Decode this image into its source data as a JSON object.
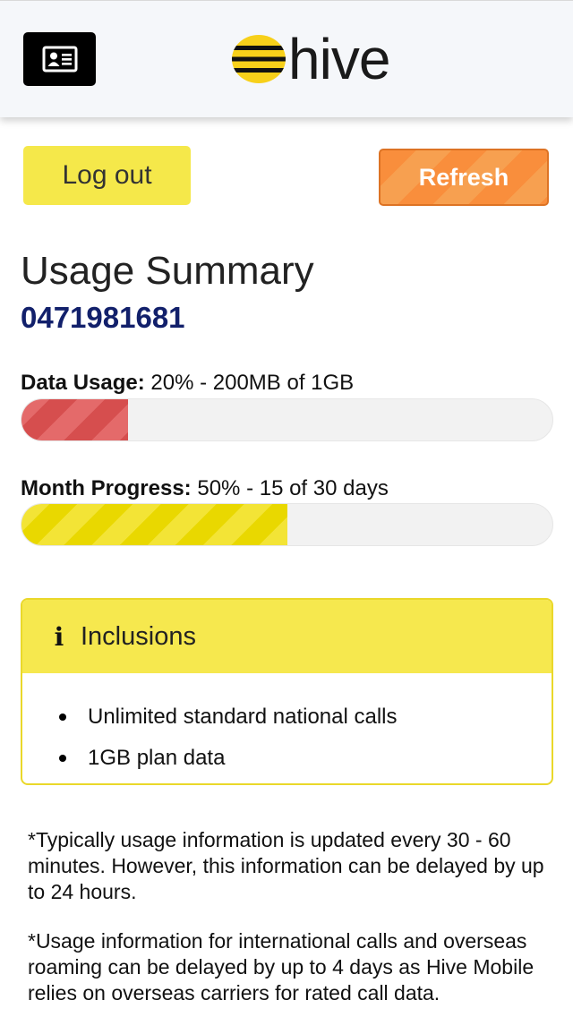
{
  "header": {
    "brand": "hive",
    "brand_color": "#f7d01a",
    "card_icon": "id-card-icon"
  },
  "actions": {
    "logout_label": "Log out",
    "refresh_label": "Refresh"
  },
  "summary": {
    "title": "Usage Summary",
    "phone": "0471981681"
  },
  "data_usage": {
    "label": "Data Usage:",
    "value_text": "20% - 200MB of 1GB",
    "percent": 20,
    "color": "#d64e4e"
  },
  "month_progress": {
    "label": "Month Progress:",
    "value_text": "50% - 15 of 30 days",
    "percent": 50,
    "color": "#e9d800"
  },
  "inclusions": {
    "icon": "info-icon",
    "title": "Inclusions",
    "items": [
      "Unlimited standard national calls",
      "1GB plan data"
    ]
  },
  "notes": [
    "*Typically usage information is updated every 30 - 60 minutes. However, this information can be delayed by up to 24 hours.",
    "*Usage information for international calls and overseas roaming can be delayed by up to 4 days as Hive Mobile relies on overseas carriers for rated call data."
  ]
}
